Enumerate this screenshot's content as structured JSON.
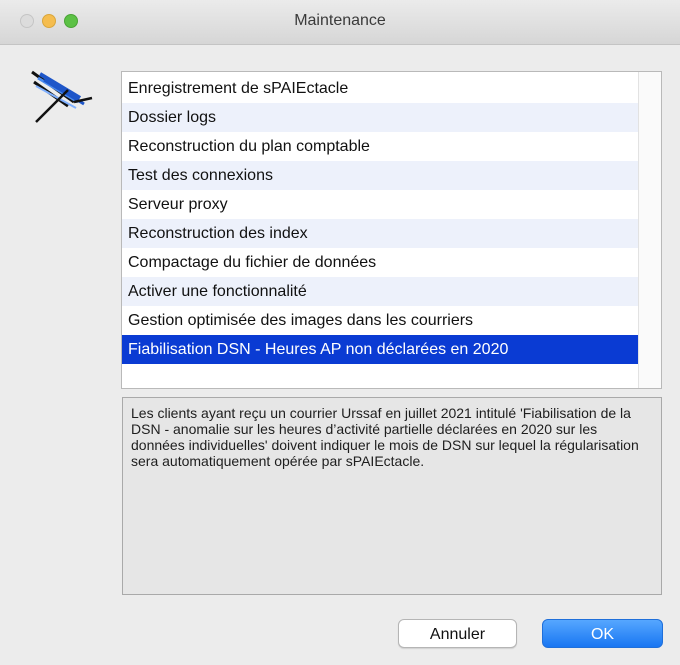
{
  "window": {
    "title": "Maintenance"
  },
  "list": {
    "items": [
      {
        "label": "Enregistrement de sPAIEctacle"
      },
      {
        "label": "Dossier logs"
      },
      {
        "label": "Reconstruction du plan comptable"
      },
      {
        "label": "Test des connexions"
      },
      {
        "label": "Serveur proxy"
      },
      {
        "label": "Reconstruction des index"
      },
      {
        "label": "Compactage du fichier de données"
      },
      {
        "label": "Activer une fonctionnalité"
      },
      {
        "label": "Gestion optimisée des images dans les courriers"
      },
      {
        "label": "Fiabilisation DSN - Heures AP non déclarées en 2020",
        "selected": true
      }
    ]
  },
  "description": {
    "text": "Les clients ayant reçu un courrier Urssaf en juillet 2021 intitulé 'Fiabilisation de la DSN - anomalie sur les heures d’activité partielle déclarées en 2020 sur les données individuelles' doivent indiquer le mois de DSN sur lequel la régularisation sera automatiquement opérée par sPAIEctacle."
  },
  "buttons": {
    "cancel_label": "Annuler",
    "ok_label": "OK"
  },
  "colors": {
    "selection": "#0a3bd3",
    "alt_row": "#edf1fb",
    "ok_button": "#1876f2"
  },
  "icons": {
    "app": "spaiectacle-logo-icon"
  }
}
